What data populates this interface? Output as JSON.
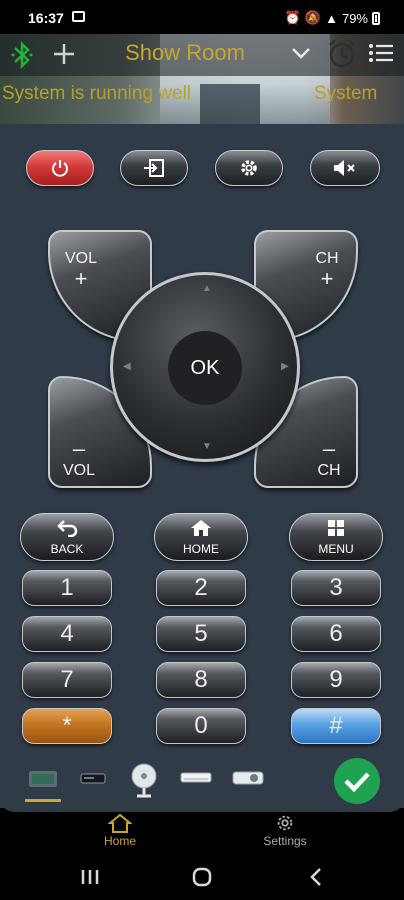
{
  "status": {
    "time": "16:37",
    "battery": "79%"
  },
  "header": {
    "room_title": "Show Room",
    "marquee": "System is running well",
    "marquee_repeat": "System"
  },
  "remote": {
    "vol_label": "VOL",
    "ch_label": "CH",
    "ok_label": "OK",
    "back_label": "BACK",
    "home_label": "HOME",
    "menu_label": "MENU",
    "keypad": [
      "1",
      "2",
      "3",
      "4",
      "5",
      "6",
      "7",
      "8",
      "9",
      "*",
      "0",
      "#"
    ]
  },
  "devices": [
    "tv-box",
    "receiver",
    "fan",
    "air-conditioner",
    "projector"
  ],
  "bottom_nav": [
    {
      "label": "Home",
      "icon": "home-icon",
      "active": true
    },
    {
      "label": "Settings",
      "icon": "gear-icon",
      "active": false
    }
  ],
  "colors": {
    "accent": "#c9a72a",
    "panel": "#303b48",
    "power": "#d33a3a",
    "confirm": "#20a350",
    "bluetooth": "#1fb53a"
  }
}
